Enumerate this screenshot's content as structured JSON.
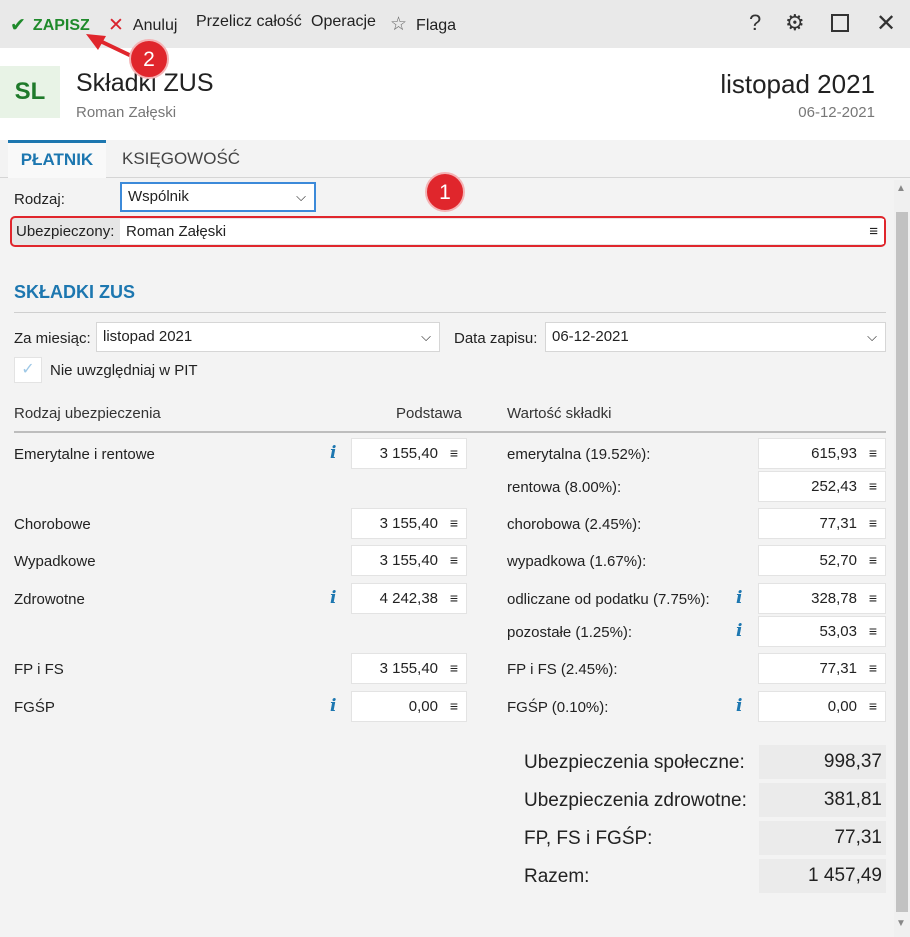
{
  "toolbar": {
    "save": "ZAPISZ",
    "cancel": "Anuluj",
    "recalc": "Przelicz całość",
    "operations": "Operacje",
    "flag": "Flaga",
    "help": "?",
    "save_icon": "check-icon",
    "cancel_icon": "x-icon",
    "flag_icon": "star-icon"
  },
  "header": {
    "logo": "SL",
    "title": "Składki ZUS",
    "subtitle": "Roman Załęski",
    "period": "listopad 2021",
    "date": "06-12-2021"
  },
  "tabs": [
    "PŁATNIK",
    "KSIĘGOWOŚĆ"
  ],
  "form": {
    "type_label": "Rodzaj:",
    "type_value": "Wspólnik",
    "insured_label": "Ubezpieczony:",
    "insured_value": "Roman Załęski"
  },
  "section": {
    "title": "SKŁADKI ZUS",
    "month_label": "Za miesiąc:",
    "month_value": "listopad 2021",
    "save_date_label": "Data zapisu:",
    "save_date_value": "06-12-2021",
    "pit_checkbox_label": "Nie uwzględniaj w PIT"
  },
  "table": {
    "headers": {
      "type": "Rodzaj ubezpieczenia",
      "base": "Podstawa",
      "value": "Wartość składki"
    },
    "rows": [
      {
        "name": "Emerytalne i rentowe",
        "base": "3 155,40"
      },
      {
        "name": "Chorobowe",
        "base": "3 155,40"
      },
      {
        "name": "Wypadkowe",
        "base": "3 155,40"
      },
      {
        "name": "Zdrowotne",
        "base": "4 242,38"
      },
      {
        "name": "FP i FS",
        "base": "3 155,40"
      },
      {
        "name": "FGŚP",
        "base": "0,00"
      }
    ],
    "contributions": [
      {
        "label": "emerytalna (19.52%):",
        "value": "615,93"
      },
      {
        "label": "rentowa (8.00%):",
        "value": "252,43"
      },
      {
        "label": "chorobowa (2.45%):",
        "value": "77,31"
      },
      {
        "label": "wypadkowa (1.67%):",
        "value": "52,70"
      },
      {
        "label": "odliczane od podatku (7.75%):",
        "value": "328,78"
      },
      {
        "label": "pozostałe (1.25%):",
        "value": "53,03"
      },
      {
        "label": "FP i FS (2.45%):",
        "value": "77,31"
      },
      {
        "label": "FGŚP (0.10%):",
        "value": "0,00"
      }
    ]
  },
  "summary": [
    {
      "label": "Ubezpieczenia społeczne:",
      "value": "998,37"
    },
    {
      "label": "Ubezpieczenia zdrowotne:",
      "value": "381,81"
    },
    {
      "label": "FP, FS i FGŚP:",
      "value": "77,31"
    },
    {
      "label": "Razem:",
      "value": "1 457,49"
    }
  ],
  "annotations": {
    "badge1": "1",
    "badge2": "2",
    "accent_color": "#e0262c"
  },
  "colors": {
    "brand_blue": "#1d77b0",
    "save_green": "#1f8a2b"
  }
}
